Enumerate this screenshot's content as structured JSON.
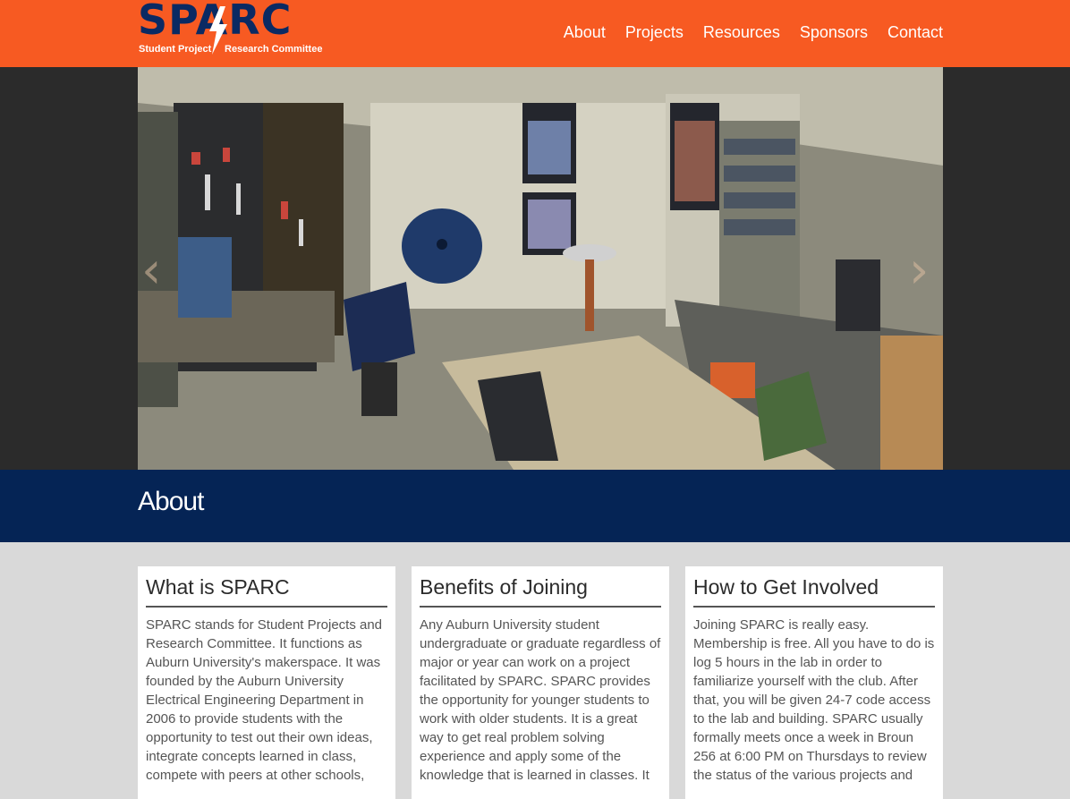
{
  "header": {
    "logo_title": "SPARC",
    "logo_sub_left": "Student Project",
    "logo_sub_right": "Research Committee",
    "nav": [
      "About",
      "Projects",
      "Resources",
      "Sponsors",
      "Contact"
    ]
  },
  "hero": {
    "prev_arrow": "‹",
    "next_arrow": "›"
  },
  "about": {
    "title": "About",
    "cards": [
      {
        "title": "What is SPARC",
        "body": "SPARC stands for Student Projects and Research Committee. It functions as Auburn University's makerspace. It was founded by the Auburn University Electrical Engineering Department in 2006 to provide students with the opportunity to test out their own ideas, integrate concepts learned in class, compete with peers at other schools,"
      },
      {
        "title": "Benefits of Joining",
        "body": "Any Auburn University student undergraduate or graduate regardless of major or year can work on a project facilitated by SPARC. SPARC provides the opportunity for younger students to work with older students. It is a great way to get real problem solving experience and apply some of the knowledge that is learned in classes. It"
      },
      {
        "title": "How to Get Involved",
        "body": "Joining SPARC is really easy. Membership is free. All you have to do is log 5 hours in the lab in order to familiarize yourself with the club. After that, you will be given 24-7 code access to the lab and building. SPARC usually formally meets once a week in Broun 256 at 6:00 PM on Thursdays to review the status of the various projects and"
      }
    ]
  },
  "colors": {
    "header": "#f75a22",
    "band": "#052455",
    "logo": "#0a2a63"
  }
}
